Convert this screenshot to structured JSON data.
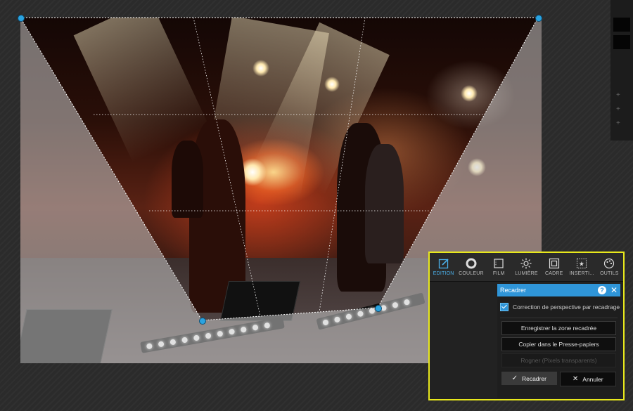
{
  "toolbar": {
    "tools": [
      {
        "label": "EDITION",
        "icon": "edit-icon",
        "active": true
      },
      {
        "label": "COULEUR",
        "icon": "color-circle-icon",
        "active": false
      },
      {
        "label": "FILM",
        "icon": "film-icon",
        "active": false
      },
      {
        "label": "LUMIÈRE",
        "icon": "sun-icon",
        "active": false
      },
      {
        "label": "CADRE",
        "icon": "frame-icon",
        "active": false
      },
      {
        "label": "INSERTI...",
        "icon": "insert-star-icon",
        "active": false
      },
      {
        "label": "OUTILS",
        "icon": "palette-icon",
        "active": false
      }
    ]
  },
  "crop_dialog": {
    "title": "Recadrer",
    "help_label": "?",
    "close_label": "✕",
    "perspective_checkbox": {
      "label": "Correction de perspective par recadrage",
      "checked": true
    },
    "save_zone_button": "Enregistrer la zone recadrée",
    "copy_clipboard_button": "Copier dans le Presse-papiers",
    "crop_transparent_button": "Rogner (Pixels transparents)",
    "crop_button": "Recadrer",
    "cancel_button": "Annuler"
  },
  "colors": {
    "accent": "#2f95d8",
    "highlight": "#e8e81c",
    "annotation_arrow": "#f5f511"
  }
}
